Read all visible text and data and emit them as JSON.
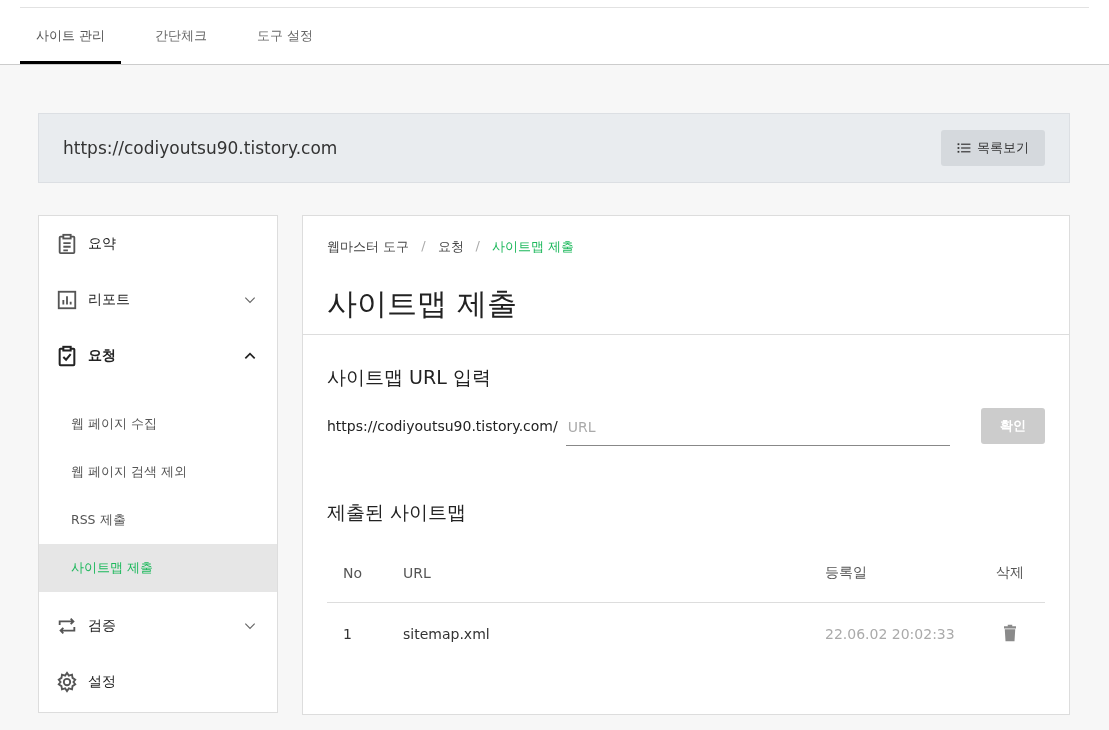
{
  "tabs": [
    {
      "label": "사이트 관리",
      "selected": true
    },
    {
      "label": "간단체크",
      "selected": false
    },
    {
      "label": "도구 설정",
      "selected": false
    }
  ],
  "site_bar": {
    "url": "https://codiyoutsu90.tistory.com",
    "list_button": "목록보기"
  },
  "sidebar": {
    "items": [
      {
        "label": "요약",
        "kind": "link"
      },
      {
        "label": "리포트",
        "kind": "group",
        "expanded": false
      },
      {
        "label": "요청",
        "kind": "group",
        "expanded": true,
        "children": [
          {
            "label": "웹 페이지 수집",
            "selected": false
          },
          {
            "label": "웹 페이지 검색 제외",
            "selected": false
          },
          {
            "label": "RSS 제출",
            "selected": false
          },
          {
            "label": "사이트맵 제출",
            "selected": true
          }
        ]
      },
      {
        "label": "검증",
        "kind": "group",
        "expanded": false
      },
      {
        "label": "설정",
        "kind": "link"
      }
    ]
  },
  "breadcrumb": [
    {
      "label": "웹마스터 도구",
      "current": false
    },
    {
      "label": "요청",
      "current": false
    },
    {
      "label": "사이트맵 제출",
      "current": true
    }
  ],
  "breadcrumb_separator": "/",
  "page_title": "사이트맵 제출",
  "url_section": {
    "heading": "사이트맵 URL 입력",
    "prefix": "https://codiyoutsu90.tistory.com/",
    "placeholder": "URL",
    "button": "확인",
    "button_disabled": true
  },
  "submitted": {
    "heading": "제출된 사이트맵",
    "columns": [
      "No",
      "URL",
      "등록일",
      "삭제"
    ],
    "rows": [
      {
        "no": "1",
        "url": "sitemap.xml",
        "date": "22.06.02 20:02:33"
      }
    ]
  }
}
